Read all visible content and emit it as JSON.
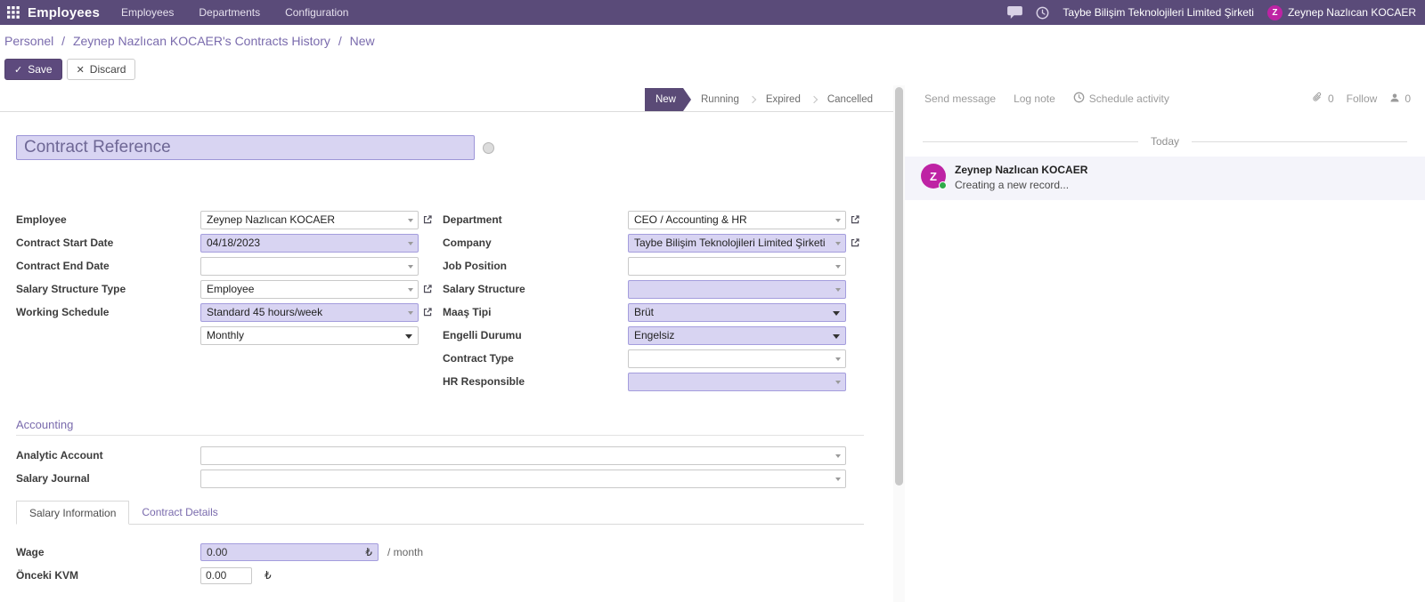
{
  "colors": {
    "navbar_bg": "#5a4b79",
    "accent_purple": "#7a6bad",
    "required_field_bg": "#d8d4f2",
    "stage_active_bg": "#5a4a76",
    "avatar_magenta": "#be23a4",
    "presence_green": "#2fab49"
  },
  "navbar": {
    "brand": "Employees",
    "menus": [
      "Employees",
      "Departments",
      "Configuration"
    ],
    "company": "Taybe Bilişim Teknolojileri Limited Şirketi",
    "user_name": "Zeynep Nazlıcan KOCAER",
    "user_initial": "Z"
  },
  "breadcrumb": {
    "items": [
      "Personel",
      "Zeynep Nazlıcan KOCAER's Contracts History",
      "New"
    ],
    "separator": "/"
  },
  "actions": {
    "save": "Save",
    "discard": "Discard",
    "save_icon": "✓",
    "discard_icon": "✕"
  },
  "statusbar": {
    "stages": [
      "New",
      "Running",
      "Expired",
      "Cancelled"
    ],
    "active": "New"
  },
  "form": {
    "reference_placeholder": "Contract Reference",
    "fields": {
      "employee": {
        "label": "Employee",
        "value": "Zeynep Nazlıcan KOCAER"
      },
      "contract_start_date": {
        "label": "Contract Start Date",
        "value": "04/18/2023"
      },
      "contract_end_date": {
        "label": "Contract End Date",
        "value": ""
      },
      "salary_structure_type": {
        "label": "Salary Structure Type",
        "value": "Employee"
      },
      "working_schedule": {
        "label": "Working Schedule",
        "value": "Standard 45 hours/week"
      },
      "schedule_pay": {
        "value": "Monthly"
      },
      "department": {
        "label": "Department",
        "value": "CEO / Accounting & HR"
      },
      "company": {
        "label": "Company",
        "value": "Taybe Bilişim Teknolojileri Limited Şirketi"
      },
      "job_position": {
        "label": "Job Position",
        "value": ""
      },
      "salary_structure": {
        "label": "Salary Structure",
        "value": ""
      },
      "maas_tipi": {
        "label": "Maaş Tipi",
        "value": "Brüt"
      },
      "engelli_durumu": {
        "label": "Engelli Durumu",
        "value": "Engelsiz"
      },
      "contract_type": {
        "label": "Contract Type",
        "value": ""
      },
      "hr_responsible": {
        "label": "HR Responsible",
        "value": ""
      }
    },
    "accounting": {
      "title": "Accounting",
      "analytic_account": {
        "label": "Analytic Account",
        "value": ""
      },
      "salary_journal": {
        "label": "Salary Journal",
        "value": ""
      }
    },
    "tabs": [
      "Salary Information",
      "Contract Details"
    ],
    "salary": {
      "wage": {
        "label": "Wage",
        "value": "0.00",
        "currency": "₺",
        "suffix": "/ month"
      },
      "onceki_kvm": {
        "label": "Önceki KVM",
        "value": "0.00",
        "currency": "₺"
      }
    }
  },
  "chatter": {
    "send_message": "Send message",
    "log_note": "Log note",
    "schedule_activity": "Schedule activity",
    "attachments": "0",
    "follow": "Follow",
    "followers": "0",
    "today": "Today",
    "message": {
      "author": "Zeynep Nazlıcan KOCAER",
      "body": "Creating a new record...",
      "initial": "Z"
    }
  }
}
